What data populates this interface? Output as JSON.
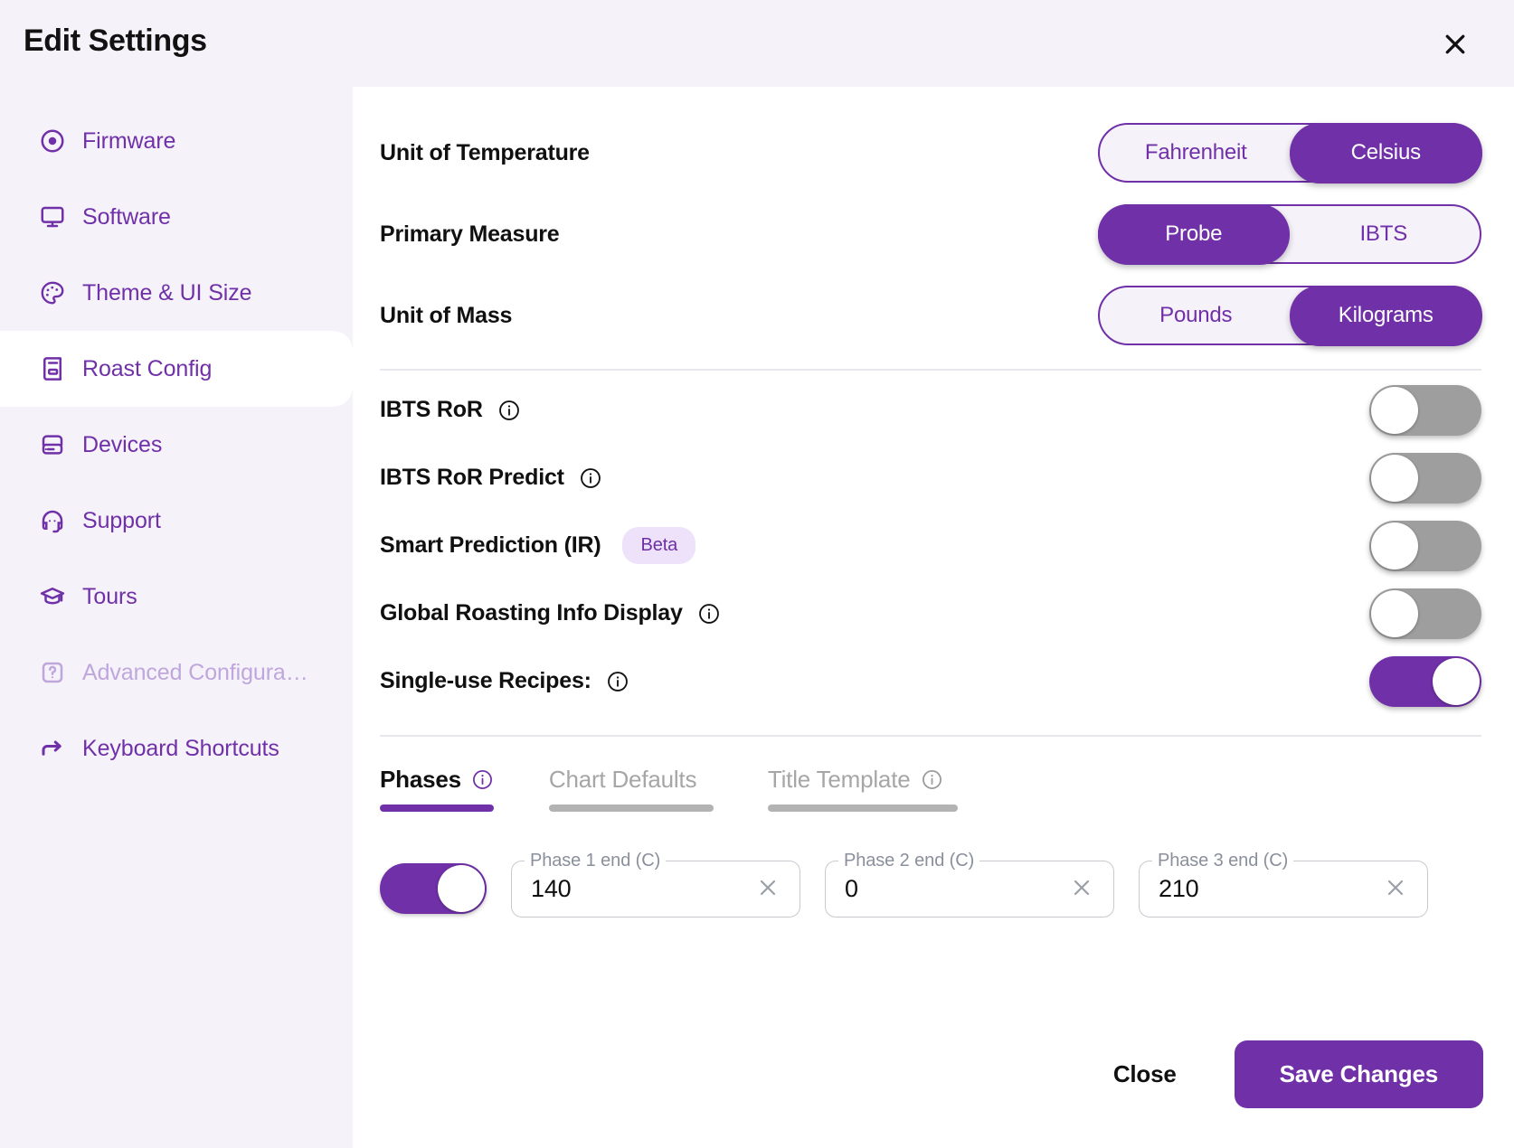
{
  "header": {
    "title": "Edit Settings",
    "close_icon": "close-icon"
  },
  "sidebar": {
    "items": [
      {
        "label": "Firmware",
        "icon": "disc-icon",
        "active": false,
        "disabled": false
      },
      {
        "label": "Software",
        "icon": "monitor-icon",
        "active": false,
        "disabled": false
      },
      {
        "label": "Theme & UI Size",
        "icon": "palette-icon",
        "active": false,
        "disabled": false
      },
      {
        "label": "Roast Config",
        "icon": "book-icon",
        "active": true,
        "disabled": false
      },
      {
        "label": "Devices",
        "icon": "hard-drive-icon",
        "active": false,
        "disabled": false
      },
      {
        "label": "Support",
        "icon": "headset-icon",
        "active": false,
        "disabled": false
      },
      {
        "label": "Tours",
        "icon": "graduation-cap-icon",
        "active": false,
        "disabled": false
      },
      {
        "label": "Advanced Configura…",
        "icon": "question-box-icon",
        "active": false,
        "disabled": true
      },
      {
        "label": "Keyboard Shortcuts",
        "icon": "arrow-turn-right-icon",
        "active": false,
        "disabled": false
      }
    ]
  },
  "main": {
    "segmented_rows": [
      {
        "label": "Unit of Temperature",
        "options": [
          "Fahrenheit",
          "Celsius"
        ],
        "selected": "Celsius"
      },
      {
        "label": "Primary Measure",
        "options": [
          "Probe",
          "IBTS"
        ],
        "selected": "Probe"
      },
      {
        "label": "Unit of Mass",
        "options": [
          "Pounds",
          "Kilograms"
        ],
        "selected": "Kilograms"
      }
    ],
    "toggle_rows": [
      {
        "label": "IBTS RoR",
        "info": true,
        "badge": null,
        "state": "off"
      },
      {
        "label": "IBTS RoR Predict",
        "info": true,
        "badge": null,
        "state": "off"
      },
      {
        "label": "Smart Prediction (IR)",
        "info": false,
        "badge": "Beta",
        "state": "off"
      },
      {
        "label": "Global Roasting Info Display",
        "info": true,
        "badge": null,
        "state": "off"
      },
      {
        "label": "Single-use Recipes:",
        "info": true,
        "badge": null,
        "state": "on"
      }
    ],
    "tabs": [
      {
        "label": "Phases",
        "info": true,
        "active": true
      },
      {
        "label": "Chart Defaults",
        "info": false,
        "active": false
      },
      {
        "label": "Title Template",
        "info": true,
        "active": false
      }
    ],
    "phases": {
      "enabled": true,
      "fields": [
        {
          "label": "Phase 1 end (C)",
          "value": "140",
          "clearable": true
        },
        {
          "label": "Phase 2 end (C)",
          "value": "0",
          "clearable": true
        },
        {
          "label": "Phase 3 end (C)",
          "value": "210",
          "clearable": true
        }
      ]
    }
  },
  "footer": {
    "close_label": "Close",
    "save_label": "Save Changes"
  },
  "colors": {
    "brand_purple": "#7030a8",
    "sidebar_bg": "#f5f2fa",
    "toggle_off": "#9e9e9e",
    "badge_bg": "#eee2fb"
  }
}
